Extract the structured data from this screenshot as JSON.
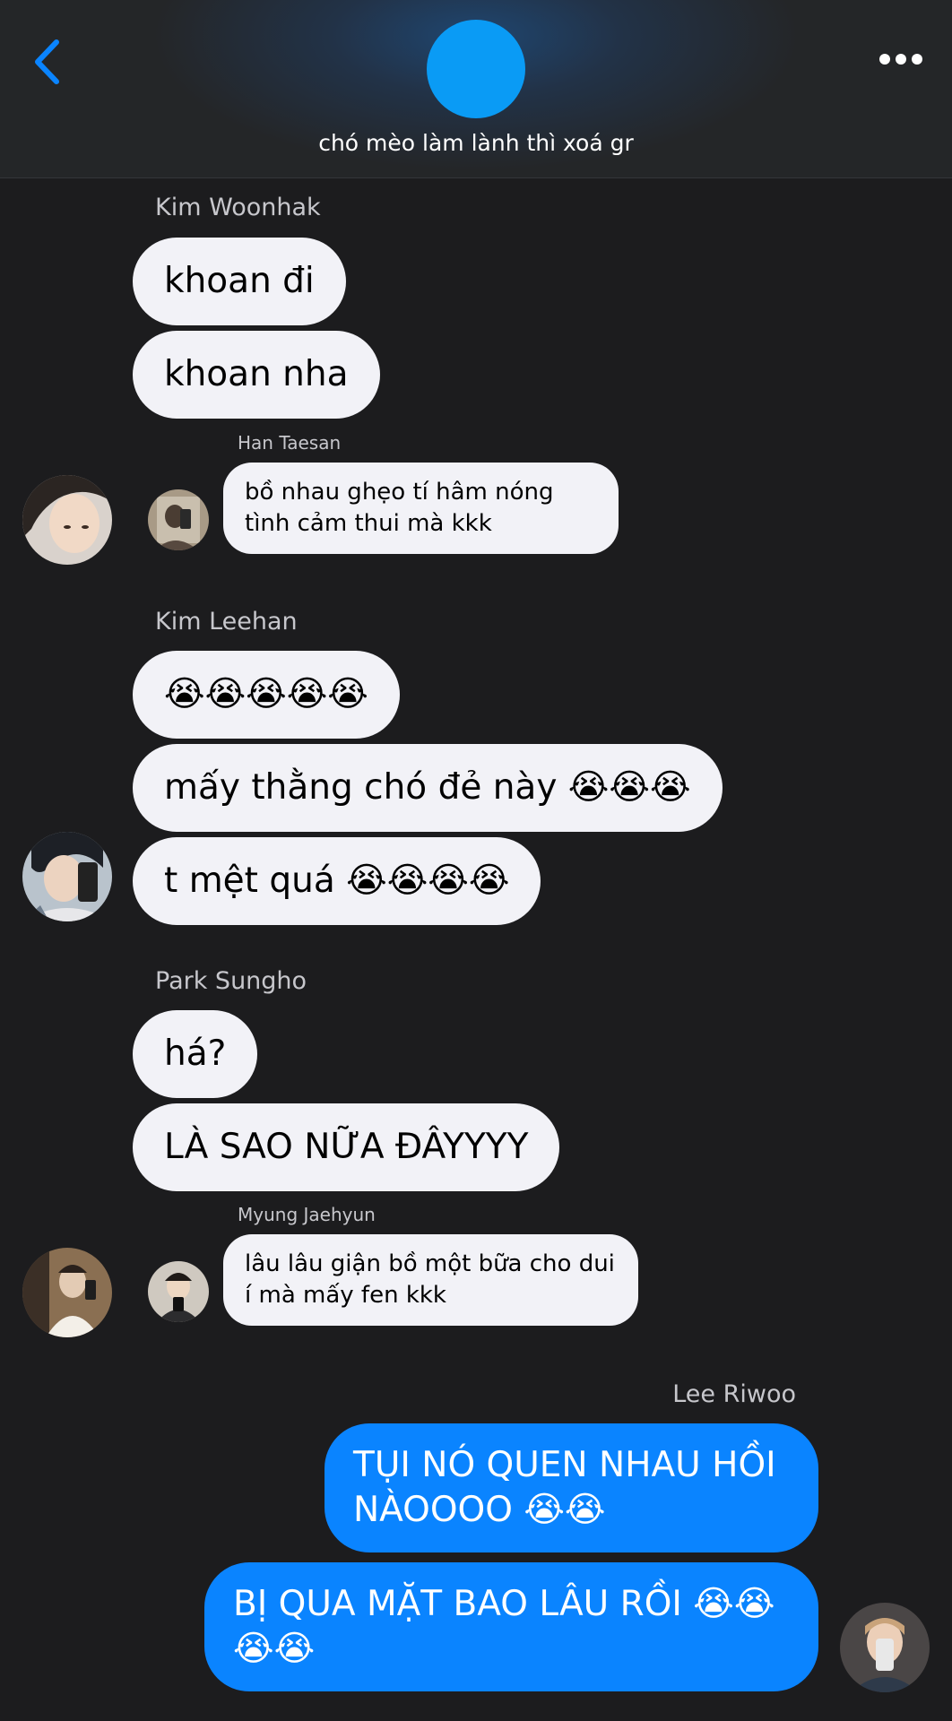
{
  "header": {
    "title": "chó mèo làm lành thì xoá gr",
    "back_icon": "chevron-left-icon",
    "more_icon": "ellipsis-icon",
    "accent_color": "#0a84ff",
    "group_avatar_color": "#0a9bf5"
  },
  "messages": {
    "woonhak": {
      "sender": "Kim Woonhak",
      "bubbles": [
        "khoan đi",
        "khoan nha"
      ]
    },
    "taesan": {
      "sender": "Han Taesan",
      "text": "bồ nhau ghẹo tí hâm nóng tình cảm thui mà kkk"
    },
    "leehan": {
      "sender": "Kim Leehan",
      "bubbles": [
        "😭😭😭😭😭",
        "mấy thằng chó đẻ này 😭😭😭",
        "t mệt quá 😭😭😭😭"
      ]
    },
    "sungho": {
      "sender": "Park Sungho",
      "bubbles": [
        "há?",
        "LÀ SAO NỮA ĐÂYYYY"
      ]
    },
    "jaehyun": {
      "sender": "Myung Jaehyun",
      "text": "lâu lâu giận bồ một bữa cho dui í mà mấy fen kkk"
    },
    "riwoo": {
      "sender": "Lee Riwoo",
      "bubbles": [
        "TỤI NÓ QUEN NHAU HỒI NÀOOOO 😭😭",
        "BỊ QUA MẶT BAO LÂU RỒI 😭😭😭😭"
      ]
    }
  }
}
